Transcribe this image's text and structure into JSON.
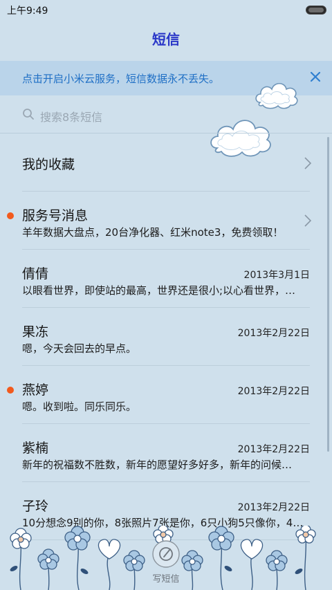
{
  "status_bar": {
    "time": "上午9:49"
  },
  "header": {
    "title": "短信"
  },
  "banner": {
    "text": "点击开启小米云服务，短信数据永不丢失。"
  },
  "search": {
    "placeholder": "搜索8条短信"
  },
  "favorites": {
    "label": "我的收藏"
  },
  "conversations": [
    {
      "name": "服务号消息",
      "date": "",
      "snippet": "羊年数据大盘点，20台净化器、红米note3，免费领取！",
      "unread": true,
      "chevron": true
    },
    {
      "name": "倩倩",
      "date": "2013年3月1日",
      "snippet": "以眼看世界，即使站的最高，世界还是很小;以心看世界，…",
      "unread": false,
      "chevron": false
    },
    {
      "name": "果冻",
      "date": "2013年2月22日",
      "snippet": "嗯，今天会回去的早点。",
      "unread": false,
      "chevron": false
    },
    {
      "name": "燕婷",
      "date": "2013年2月22日",
      "snippet": "嗯。收到啦。同乐同乐。",
      "unread": true,
      "chevron": false
    },
    {
      "name": "紫楠",
      "date": "2013年2月22日",
      "snippet": "新年的祝福数不胜数，新年的愿望好多好多，新年的问候…",
      "unread": false,
      "chevron": false
    },
    {
      "name": "子玲",
      "date": "2013年2月22日",
      "snippet": "10分想念9别的你，8张照片7张是你，6只小狗5只像你，4…",
      "unread": false,
      "chevron": false
    }
  ],
  "compose": {
    "label": "写短信"
  },
  "colors": {
    "accent": "#2a37c8",
    "banner_text": "#1f6fc5",
    "unread_dot": "#f25a1d",
    "background": "#cfe0ec"
  }
}
